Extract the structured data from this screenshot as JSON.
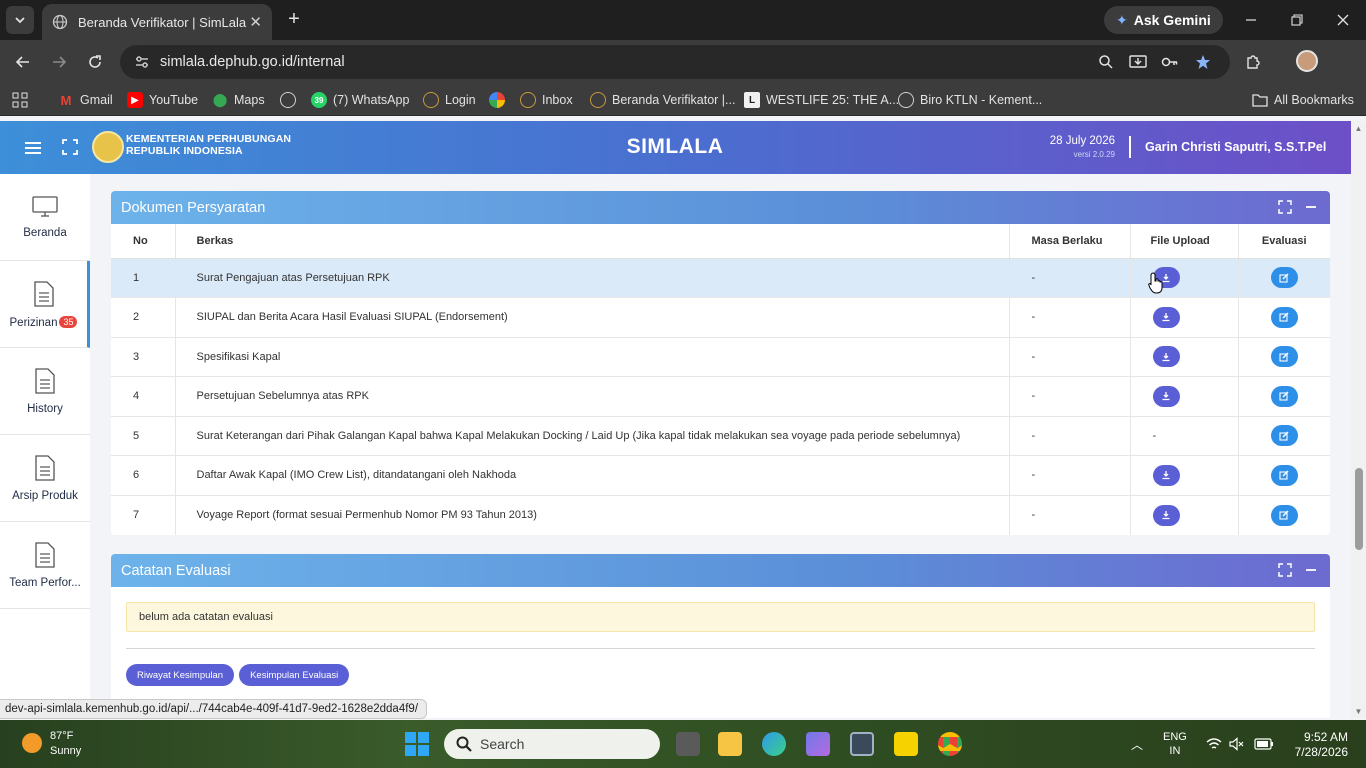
{
  "browser": {
    "tab_title": "Beranda Verifikator | SimLala",
    "url": "simlala.dephub.go.id/internal",
    "ask_gemini": "Ask Gemini",
    "status_url": "dev-api-simlala.kemenhub.go.id/api/.../744cab4e-409f-41d7-9ed2-1628e2dda4f9/"
  },
  "bookmarks": [
    {
      "label": "Gmail"
    },
    {
      "label": "YouTube"
    },
    {
      "label": "Maps"
    },
    {
      "label": ""
    },
    {
      "label": "(7) WhatsApp",
      "count": "39"
    },
    {
      "label": "Login"
    },
    {
      "label": ""
    },
    {
      "label": "Inbox"
    },
    {
      "label": "Beranda Verifikator |..."
    },
    {
      "label": "WESTLIFE 25: THE A..."
    },
    {
      "label": "Biro KTLN - Kement..."
    }
  ],
  "all_bookmarks": "All Bookmarks",
  "header": {
    "ministry_line1": "KEMENTERIAN PERHUBUNGAN",
    "ministry_line2": "REPUBLIK INDONESIA",
    "app_title": "SIMLALA",
    "date": "28 July 2026",
    "version": "versi 2.0.29",
    "user": "Garin Christi Saputri, S.S.T.Pel"
  },
  "sidebar": {
    "items": [
      {
        "label": "Beranda"
      },
      {
        "label": "Perizinan",
        "badge": "35"
      },
      {
        "label": "History"
      },
      {
        "label": "Arsip Produk"
      },
      {
        "label": "Team Perfor..."
      }
    ]
  },
  "dokumen": {
    "title": "Dokumen Persyaratan",
    "columns": {
      "no": "No",
      "berkas": "Berkas",
      "masa": "Masa Berlaku",
      "file": "File Upload",
      "eval": "Evaluasi"
    },
    "rows": [
      {
        "no": "1",
        "berkas": "Surat Pengajuan atas Persetujuan RPK",
        "masa": "-",
        "file": "download"
      },
      {
        "no": "2",
        "berkas": "SIUPAL dan Berita Acara Hasil Evaluasi SIUPAL (Endorsement)",
        "masa": "-",
        "file": "download"
      },
      {
        "no": "3",
        "berkas": "Spesifikasi Kapal",
        "masa": "-",
        "file": "download"
      },
      {
        "no": "4",
        "berkas": "Persetujuan Sebelumnya atas RPK",
        "masa": "-",
        "file": "download"
      },
      {
        "no": "5",
        "berkas": "Surat Keterangan dari Pihak Galangan Kapal bahwa Kapal Melakukan Docking / Laid Up (Jika kapal tidak melakukan sea voyage pada periode sebelumnya)",
        "masa": "-",
        "file": "-"
      },
      {
        "no": "6",
        "berkas": "Daftar Awak Kapal (IMO Crew List), ditandatangani oleh Nakhoda",
        "masa": "-",
        "file": "download"
      },
      {
        "no": "7",
        "berkas": "Voyage Report (format sesuai Permenhub Nomor PM 93 Tahun 2013)",
        "masa": "-",
        "file": "download"
      }
    ]
  },
  "catatan": {
    "title": "Catatan Evaluasi",
    "note": "belum ada catatan evaluasi",
    "btn_riwayat": "Riwayat Kesimpulan",
    "btn_kesimpulan": "Kesimpulan Evaluasi"
  },
  "taskbar": {
    "temp": "87°F",
    "weather": "Sunny",
    "search": "Search",
    "lang1": "ENG",
    "lang2": "IN",
    "time": "9:52 AM",
    "date": "7/28/2026"
  },
  "colors": {
    "header_start": "#3d8fd8",
    "header_end": "#6d4fc8",
    "download_btn": "#5a5fd6",
    "eval_btn": "#2d8fe8",
    "badge": "#e8453c"
  }
}
